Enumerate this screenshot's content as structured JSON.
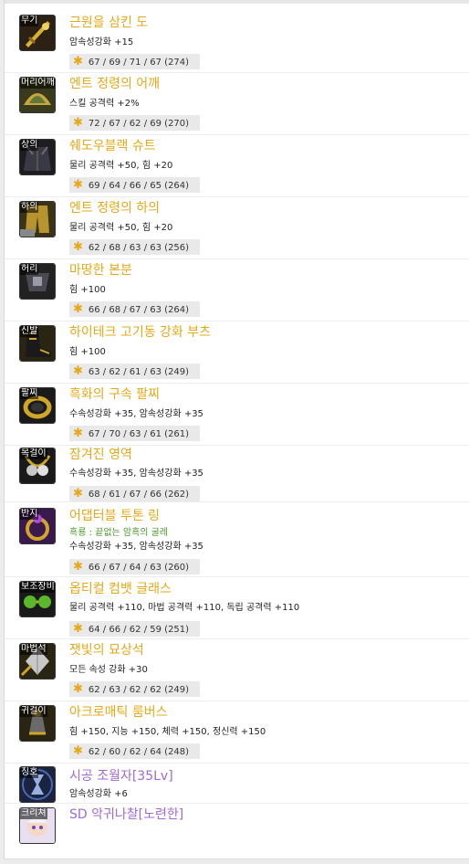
{
  "colors": {
    "item_name": "#e6a817",
    "special_name": "#a06ad4",
    "option_green": "#4c9a2a"
  },
  "items": [
    {
      "slot": "무기",
      "name": "근원을 삼킨 도",
      "stats": [
        "암속성강화 +15"
      ],
      "scores": "67 / 69 / 71 / 67 (274)",
      "icon": "sword-icon"
    },
    {
      "slot": "머리어깨",
      "name": "엔트 정령의 어깨",
      "stats": [
        "스킬 공격력 +2%"
      ],
      "scores": "72 / 67 / 62 / 69 (270)",
      "icon": "shoulder-armor-icon"
    },
    {
      "slot": "상의",
      "name": "쉐도우블랙 슈트",
      "stats": [
        "물리 공격력 +50, 힘 +20"
      ],
      "scores": "69 / 64 / 66 / 65 (264)",
      "icon": "top-armor-icon"
    },
    {
      "slot": "하의",
      "name": "엔트 정령의 하의",
      "stats": [
        "물리 공격력 +50, 힘 +20"
      ],
      "scores": "62 / 68 / 63 / 63 (256)",
      "icon": "bottom-armor-icon"
    },
    {
      "slot": "허리",
      "name": "마땅한 본분",
      "stats": [
        "힘 +100"
      ],
      "scores": "66 / 68 / 67 / 63 (264)",
      "icon": "belt-icon"
    },
    {
      "slot": "신발",
      "name": "하이테크 고기동 강화 부츠",
      "stats": [
        "힘 +100"
      ],
      "scores": "63 / 62 / 61 / 63 (249)",
      "icon": "boots-icon"
    },
    {
      "slot": "팔찌",
      "name": "흑화의 구속 팔찌",
      "stats": [
        "수속성강화 +35, 암속성강화 +35"
      ],
      "scores": "67 / 70 / 63 / 61 (261)",
      "icon": "bracelet-icon"
    },
    {
      "slot": "목걸이",
      "name": "잠겨진 영역",
      "stats": [
        "수속성강화 +35, 암속성강화 +35"
      ],
      "scores": "68 / 61 / 67 / 66 (262)",
      "icon": "necklace-icon"
    },
    {
      "slot": "반지",
      "name": "어댑터블 투톤 링",
      "green": "흑룡 : 끝없는 암흑의 굴레",
      "stats": [
        "수속성강화 +35, 암속성강화 +35"
      ],
      "scores": "66 / 67 / 64 / 63 (260)",
      "icon": "ring-icon"
    },
    {
      "slot": "보조장비",
      "name": "옵티컬 컴뱃 글래스",
      "stats": [
        "물리 공격력 +110, 마법 공격력 +110, 독립 공격력 +110"
      ],
      "scores": "64 / 66 / 62 / 59 (251)",
      "icon": "glasses-icon"
    },
    {
      "slot": "마법석",
      "name": "잿빛의 묘상석",
      "stats": [
        "모든 속성 강화 +30"
      ],
      "scores": "62 / 63 / 62 / 62 (249)",
      "icon": "magic-stone-icon"
    },
    {
      "slot": "귀걸이",
      "name": "아크로매틱 룸버스",
      "stats": [
        "힘 +150, 지능 +150, 체력 +150, 정신력 +150"
      ],
      "scores": "62 / 60 / 62 / 64 (248)",
      "icon": "earring-icon"
    },
    {
      "slot": "칭호",
      "name": "시공 조월자[35Lv]",
      "stats": [
        "암속성강화 +6"
      ],
      "icon": "title-icon",
      "special": true
    },
    {
      "slot": "크리쳐",
      "name": "SD 악귀나찰[노련한]",
      "stats": [],
      "icon": "creature-icon",
      "special": true
    }
  ]
}
